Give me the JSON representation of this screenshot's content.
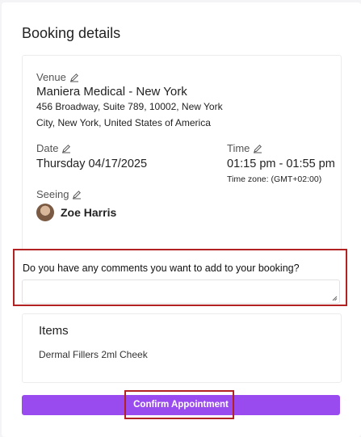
{
  "title": "Booking details",
  "venue": {
    "label": "Venue",
    "name": "Maniera Medical - New York",
    "address_line1": "456 Broadway, Suite 789, 10002, New York",
    "address_line2": "City, New York, United States of America"
  },
  "date": {
    "label": "Date",
    "value": "Thursday 04/17/2025"
  },
  "time": {
    "label": "Time",
    "value": "01:15 pm - 01:55 pm",
    "timezone": "Time zone: (GMT+02:00)"
  },
  "seeing": {
    "label": "Seeing",
    "name": "Zoe Harris"
  },
  "comments": {
    "label": "Do you have any comments you want to add to your booking?",
    "value": ""
  },
  "items": {
    "title": "Items",
    "list": [
      "Dermal Fillers 2ml Cheek"
    ]
  },
  "confirm": {
    "label": "Confirm Appointment"
  },
  "colors": {
    "accent": "#9a4bf0",
    "highlight": "#b22222"
  }
}
